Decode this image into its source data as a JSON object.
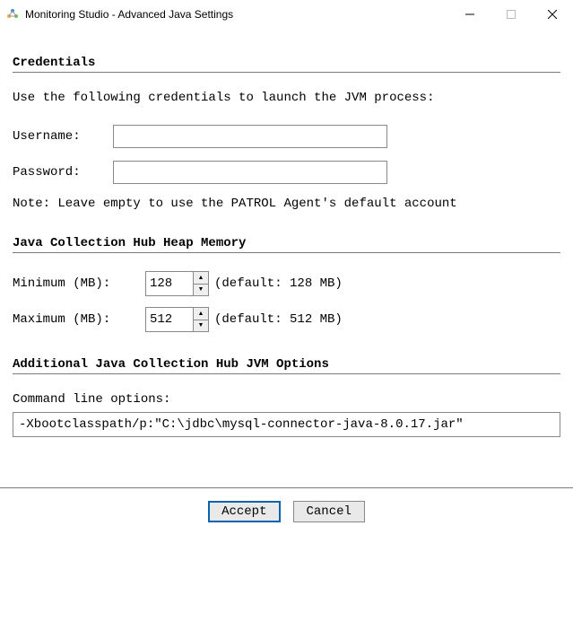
{
  "window": {
    "title": "Monitoring Studio - Advanced Java Settings"
  },
  "sections": {
    "credentials": {
      "header": "Credentials",
      "lead": "Use the following credentials to launch the JVM process:",
      "username_label": "Username:",
      "username_value": "",
      "password_label": "Password:",
      "password_value": "",
      "note": "Note: Leave empty to use the PATROL Agent's default account"
    },
    "heap": {
      "header": "Java Collection Hub Heap Memory",
      "min_label": "Minimum (MB):",
      "min_value": "128",
      "min_default": "(default: 128 MB)",
      "max_label": "Maximum (MB):",
      "max_value": "512",
      "max_default": "(default: 512 MB)"
    },
    "jvm_options": {
      "header": "Additional Java Collection Hub JVM Options",
      "cmd_label": "Command line options:",
      "cmd_value": "-Xbootclasspath/p:\"C:\\jdbc\\mysql-connector-java-8.0.17.jar\""
    }
  },
  "footer": {
    "accept": "Accept",
    "cancel": "Cancel"
  }
}
